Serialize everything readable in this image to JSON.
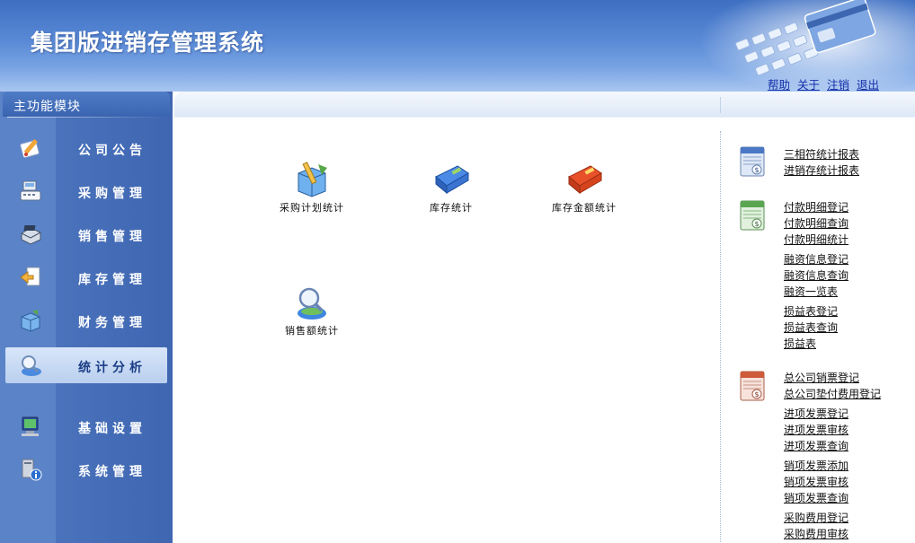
{
  "header": {
    "title": "集团版进销存管理系统",
    "links": [
      "帮助",
      "关于",
      "注销",
      "退出"
    ]
  },
  "sidebar": {
    "title": "主功能模块",
    "items": [
      {
        "label": "公司公告",
        "icon": "pencil-document-icon"
      },
      {
        "label": "采购管理",
        "icon": "cash-register-icon"
      },
      {
        "label": "销售管理",
        "icon": "scanner-icon"
      },
      {
        "label": "库存管理",
        "icon": "document-arrow-icon"
      },
      {
        "label": "财务管理",
        "icon": "box-icon"
      },
      {
        "label": "统计分析",
        "icon": "magnifier-person-icon"
      },
      {
        "label": "基础设置",
        "icon": "computer-icon"
      },
      {
        "label": "系统管理",
        "icon": "pc-info-icon"
      }
    ],
    "active_index": 5
  },
  "features": [
    {
      "label": "采购计划统计",
      "icon": "ruler-box-icon"
    },
    {
      "label": "库存统计",
      "icon": "blue-folder-icon"
    },
    {
      "label": "库存金额统计",
      "icon": "red-folder-icon"
    },
    {
      "label": "销售额统计",
      "icon": "magnifier-globe-icon"
    }
  ],
  "report_groups": [
    {
      "icon": "blue-ledger-icon",
      "links": [
        "三相符统计报表",
        "进销存统计报表"
      ]
    },
    {
      "icon": "green-ledger-icon",
      "links": [
        "付款明细登记",
        "付款明细查询",
        "付款明细统计",
        "融资信息登记",
        "融资信息查询",
        "融资一览表",
        "损益表登记",
        "损益表查询",
        "损益表"
      ]
    },
    {
      "icon": "red-ledger-icon",
      "links": [
        "总公司销票登记",
        "总公司垫付费用登记",
        "进项发票登记",
        "进项发票审核",
        "进项发票查询",
        "销项发票添加",
        "销项发票审核",
        "销项发票查询",
        "采购费用登记",
        "采购费用审核"
      ]
    }
  ],
  "colors": {
    "header": "#5a8ad6",
    "sidebar": "#4a73bc",
    "link": "#1530a8",
    "active": "#c6d8f2"
  }
}
